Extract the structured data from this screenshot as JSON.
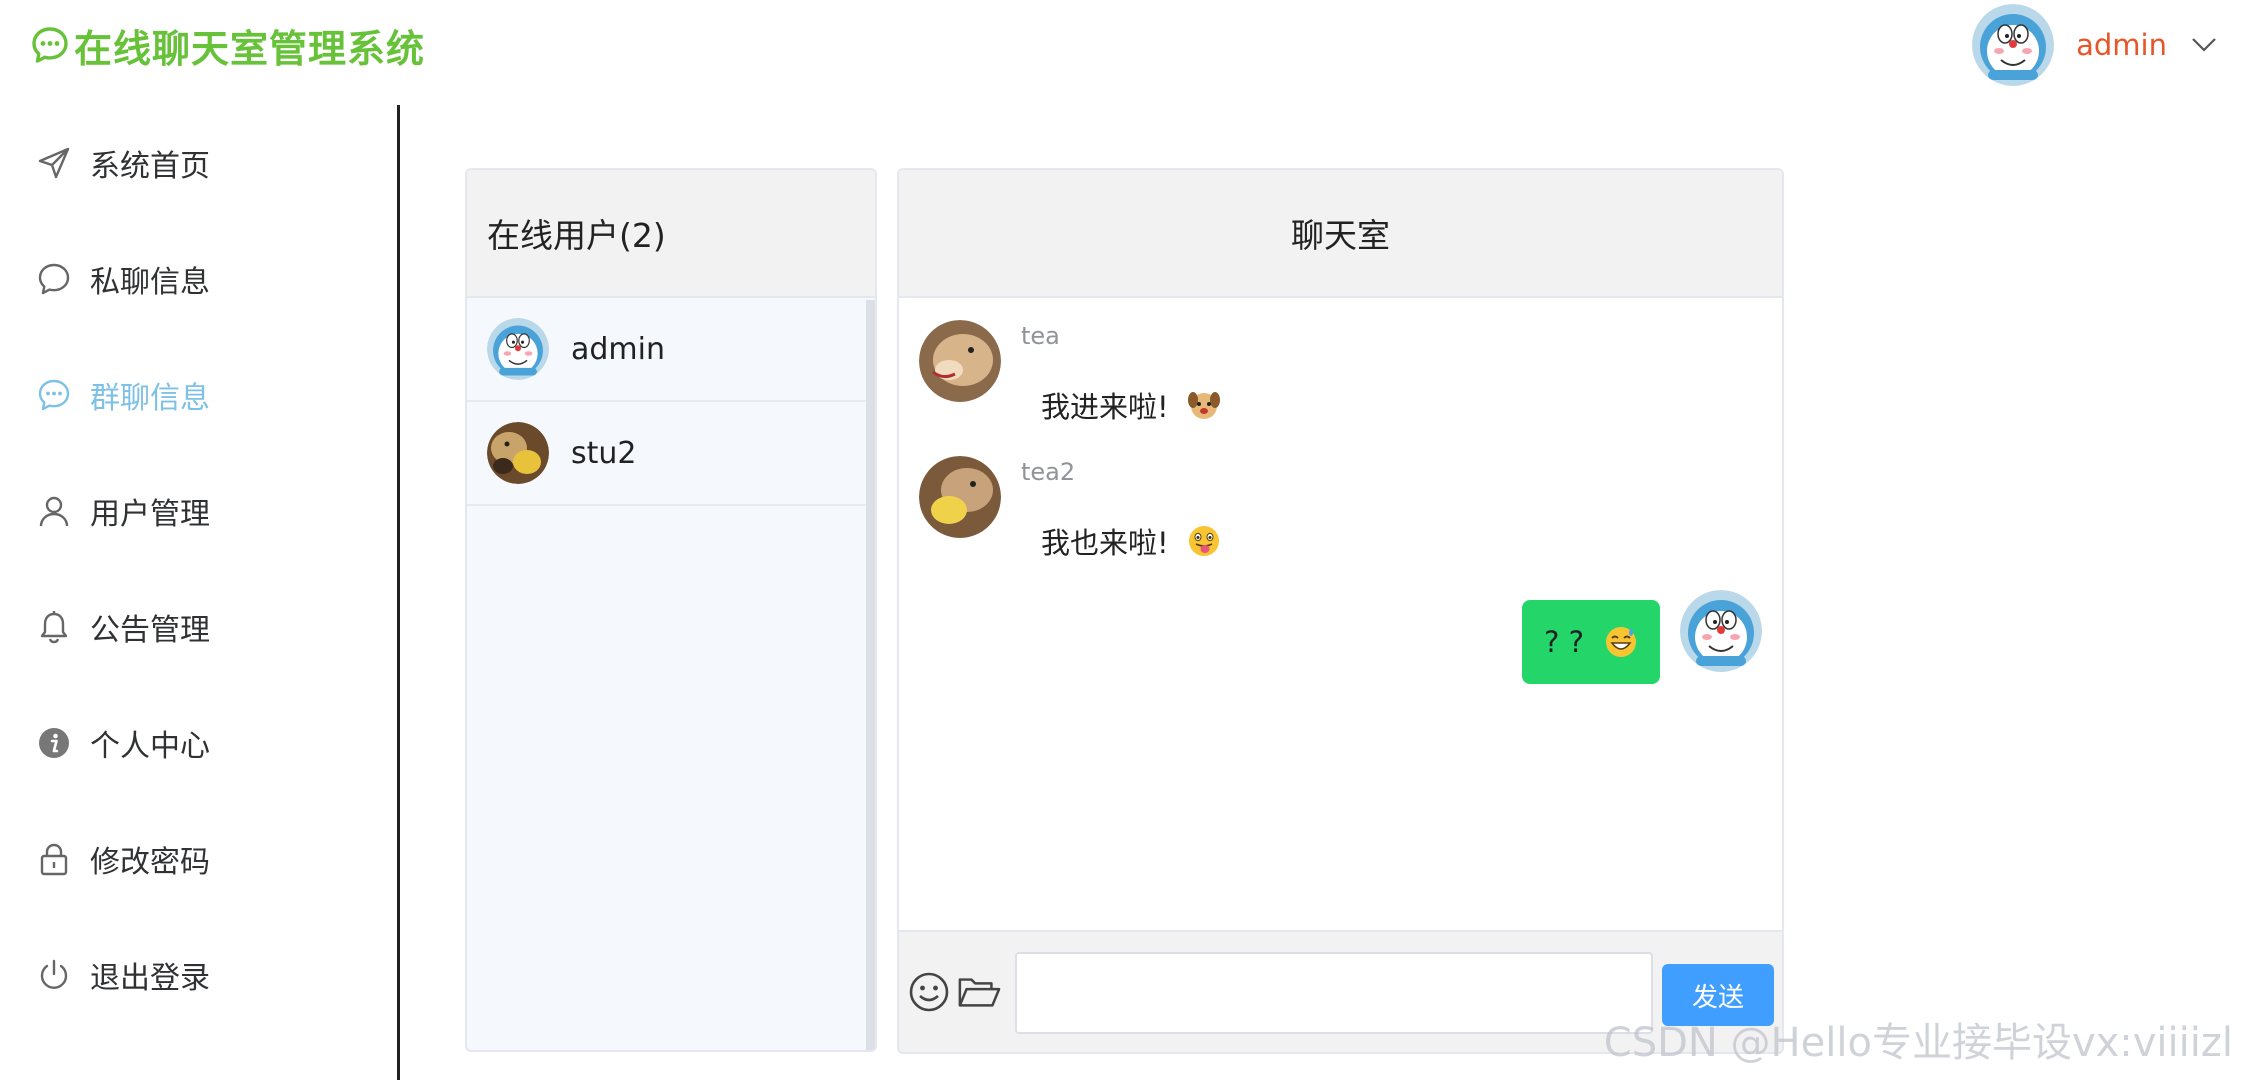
{
  "app": {
    "title": "在线聊天室管理系统",
    "current_user": "admin",
    "accent_color": "#67c23a"
  },
  "sidebar": {
    "items": [
      {
        "label": "系统首页",
        "icon": "send-icon"
      },
      {
        "label": "私聊信息",
        "icon": "chat-bubble-icon"
      },
      {
        "label": "群聊信息",
        "icon": "group-chat-icon",
        "active": true
      },
      {
        "label": "用户管理",
        "icon": "user-icon"
      },
      {
        "label": "公告管理",
        "icon": "bell-icon"
      },
      {
        "label": "个人中心",
        "icon": "info-icon"
      },
      {
        "label": "修改密码",
        "icon": "lock-icon"
      },
      {
        "label": "退出登录",
        "icon": "power-icon"
      }
    ]
  },
  "online_users": {
    "title": "在线用户(2)",
    "users": [
      {
        "name": "admin"
      },
      {
        "name": "stu2"
      }
    ]
  },
  "chat": {
    "title": "聊天室",
    "messages": [
      {
        "sender": "tea",
        "text": "我进来啦!",
        "emoji": "dog-face-emoji"
      },
      {
        "sender": "tea2",
        "text": "我也来啦!",
        "emoji": "tongue-face-emoji"
      },
      {
        "sender": "admin",
        "self": true,
        "text": "? ?",
        "emoji": "grin-sweat-emoji"
      }
    ],
    "input": {
      "value": "",
      "placeholder": ""
    },
    "send_label": "发送"
  },
  "watermark": "CSDN @Hello专业接毕设vx:viiiizl"
}
